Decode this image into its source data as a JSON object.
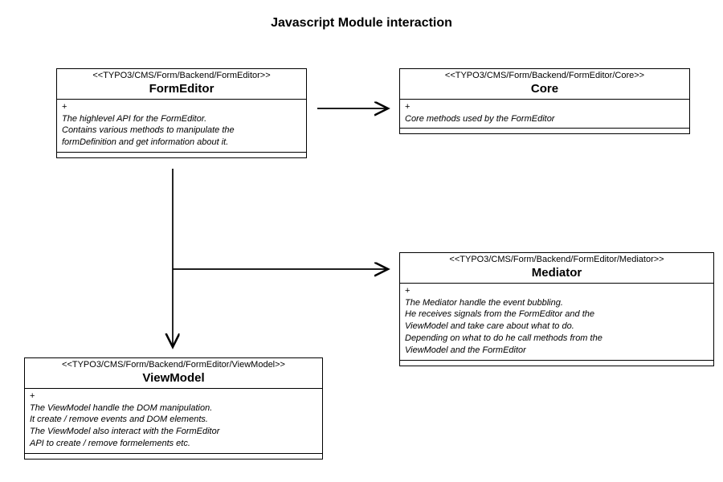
{
  "title": "Javascript Module interaction",
  "boxes": {
    "formEditor": {
      "stereotype": "<<TYPO3/CMS/Form/Backend/FormEditor>>",
      "name": "FormEditor",
      "plus": "+",
      "desc": "The highlevel API for the FormEditor.\nContains various methods to manipulate the\nformDefinition and get information about it."
    },
    "core": {
      "stereotype": "<<TYPO3/CMS/Form/Backend/FormEditor/Core>>",
      "name": "Core",
      "plus": "+",
      "desc": "Core methods used by the FormEditor"
    },
    "mediator": {
      "stereotype": "<<TYPO3/CMS/Form/Backend/FormEditor/Mediator>>",
      "name": "Mediator",
      "plus": "+",
      "desc": "The Mediator handle the event bubbling.\nHe receives signals from the FormEditor and the\nViewModel and take care about what to do.\nDepending on what to do he call methods from the\nViewModel and the FormEditor"
    },
    "viewModel": {
      "stereotype": "<<TYPO3/CMS/Form/Backend/FormEditor/ViewModel>>",
      "name": "ViewModel",
      "plus": "+",
      "desc": "The ViewModel handle the DOM manipulation.\nIt create / remove events and DOM elements.\nThe ViewModel also interact with the FormEditor\nAPI to create / remove formelements etc."
    }
  }
}
